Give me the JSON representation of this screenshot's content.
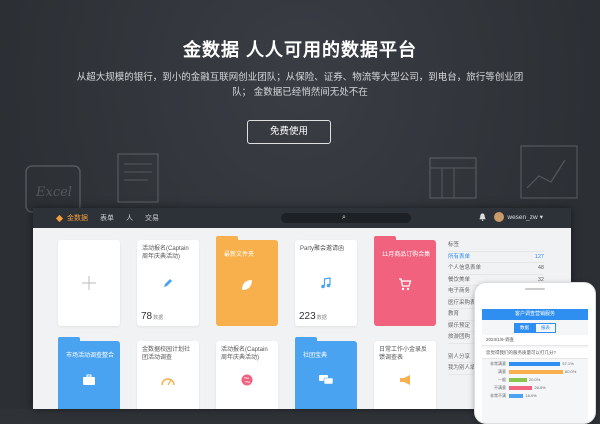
{
  "hero": {
    "title": "金数据 人人可用的数据平台",
    "subtitle": "从超大规模的银行，到小的金融互联网创业团队；从保险、证券、物流等大型公司，到电台，旅行等创业团队； 金数据已经悄然间无处不在",
    "cta": "免费使用",
    "deco_text": "Excel"
  },
  "app": {
    "brand": "金数据",
    "nav": [
      "表单",
      "人",
      "交易"
    ],
    "user": "wesen_zw",
    "colors": {
      "orange": "#f7b04c",
      "pink": "#f1627e",
      "blue": "#4aa3f0",
      "folder_blue": "#2f8ff0"
    }
  },
  "cards": [
    {
      "type": "new",
      "icon": "plus-icon"
    },
    {
      "type": "card",
      "title": "活动报名(Captain周年庆典活动)",
      "icon": "pencil-icon",
      "count": "78",
      "unit": "数据"
    },
    {
      "type": "folder",
      "title": "最新文件夹",
      "color": "#f7b04c",
      "icon": "leaf-icon"
    },
    {
      "type": "card",
      "title": "Party聚会邀请函",
      "icon": "music-icon",
      "count": "223",
      "unit": "数据"
    },
    {
      "type": "folder",
      "title": "11月商品订购合集",
      "color": "#f1627e",
      "icon": "cart-icon"
    },
    {
      "type": "folder",
      "title": "市场活动调查整合",
      "color": "#4aa3f0",
      "icon": "briefcase-icon"
    },
    {
      "type": "card",
      "title": "金数据校园计划社团活动调查",
      "icon": "gauge-icon"
    },
    {
      "type": "card",
      "title": "活动报名(Captain周年庆典活动)",
      "icon": "globe-icon"
    },
    {
      "type": "folder",
      "title": "社团宝典",
      "color": "#4aa3f0",
      "icon": "chat-icon"
    },
    {
      "type": "card",
      "title": "日常工作小金录反馈调查表",
      "icon": "megaphone-icon"
    }
  ],
  "sidebar": {
    "header": "标签",
    "rows": [
      {
        "label": "所有表单",
        "count": "127",
        "active": true
      },
      {
        "label": "个人信息表单",
        "count": "48"
      },
      {
        "label": "餐饮美单",
        "count": "32"
      },
      {
        "label": "电子商务",
        "count": ""
      },
      {
        "label": "医疗采购表单",
        "count": ""
      },
      {
        "label": "教育",
        "count": ""
      },
      {
        "label": "娱乐预定",
        "count": ""
      },
      {
        "label": "旅游团购",
        "count": ""
      }
    ],
    "bottom": [
      "别人分享",
      "我为别人填"
    ]
  },
  "phone": {
    "header": "客户调查营销服务",
    "tabs": [
      "数据",
      "报表"
    ],
    "line1": "2023/1/9-调查",
    "line2": "您觉得我们的服务质量可以打几分?",
    "bars": [
      {
        "label": "非常满意",
        "value": 57.1,
        "color": "#2f8ff0",
        "pct": "57.1%"
      },
      {
        "label": "满意",
        "value": 60.0,
        "color": "#f7b04c",
        "pct": "60.0%"
      },
      {
        "label": "一般",
        "value": 20.0,
        "color": "#8ac44b",
        "pct": "20.0%"
      },
      {
        "label": "不满意",
        "value": 26.0,
        "color": "#f1627e",
        "pct": "26.0%"
      },
      {
        "label": "非常不满",
        "value": 16.0,
        "color": "#4aa3f0",
        "pct": "16.0%"
      }
    ]
  }
}
